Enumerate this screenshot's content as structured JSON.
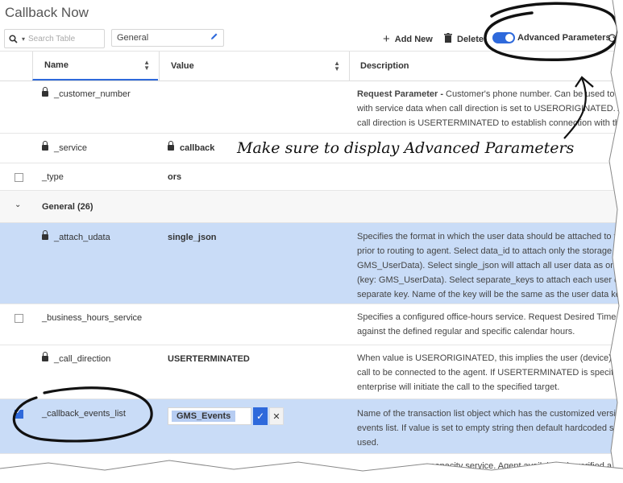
{
  "window": {
    "title": "Callback Now"
  },
  "toolbar": {
    "search_placeholder": "Search Table",
    "general_value": "General",
    "add_label": "Add New",
    "delete_label": "Delete",
    "advanced_label": "Advanced Parameters",
    "advanced_enabled": true
  },
  "table": {
    "columns": [
      "Name",
      "Value",
      "Description"
    ],
    "rows": [
      {
        "name": "_customer_number",
        "value": "",
        "locked": true,
        "desc_bold": "Request Parameter - ",
        "desc": [
          "Customer's phone number. Can be used to match t",
          "with service data when call direction is set to USERORIGINATED. Also u",
          "call direction is USERTERMINATED to establish connection with the cu"
        ]
      },
      {
        "name": "_service",
        "value": "callback",
        "locked": true,
        "value_locked": true
      },
      {
        "name": "_type",
        "value": "ors",
        "locked": false
      },
      {
        "group": "General (26)"
      },
      {
        "name": "_attach_udata",
        "value": "single_json",
        "locked": true,
        "selected": true,
        "desc": [
          "Specifies the format in which the user data should be attached to the i",
          "prior to routing to agent. Select data_id to attach only the storage data_",
          "GMS_UserData). Select single_json will attach all user data as one json c",
          "(key: GMS_UserData). Select separate_keys to attach each user data as a",
          "separate key. Name of the key will be the same as the user data key."
        ]
      },
      {
        "name": "_business_hours_service",
        "value": "",
        "locked": false,
        "desc": [
          "Specifies a configured office-hours service. Request Desired Time is veri",
          "against the defined regular and specific calendar hours."
        ]
      },
      {
        "name": "_call_direction",
        "value": "USERTERMINATED",
        "locked": true,
        "desc": [
          "When value is USERORIGINATED, this implies the user (device) will init",
          "call to be connected to the agent. If USERTERMINATED is specified, t",
          "enterprise will initiate the call to the specified target."
        ]
      },
      {
        "name": "_callback_events_list",
        "value": "GMS_Events",
        "locked": false,
        "selected": true,
        "editing": true,
        "desc": [
          "Name of the transaction list object which has the customized versic",
          "events list. If value is set to empty string then default hardcoded sev",
          "used."
        ]
      },
      {
        "partial_desc": "capacity service. Agent availability is verified a"
      }
    ]
  },
  "annotation": {
    "text": "Make sure to display Advanced Parameters"
  }
}
